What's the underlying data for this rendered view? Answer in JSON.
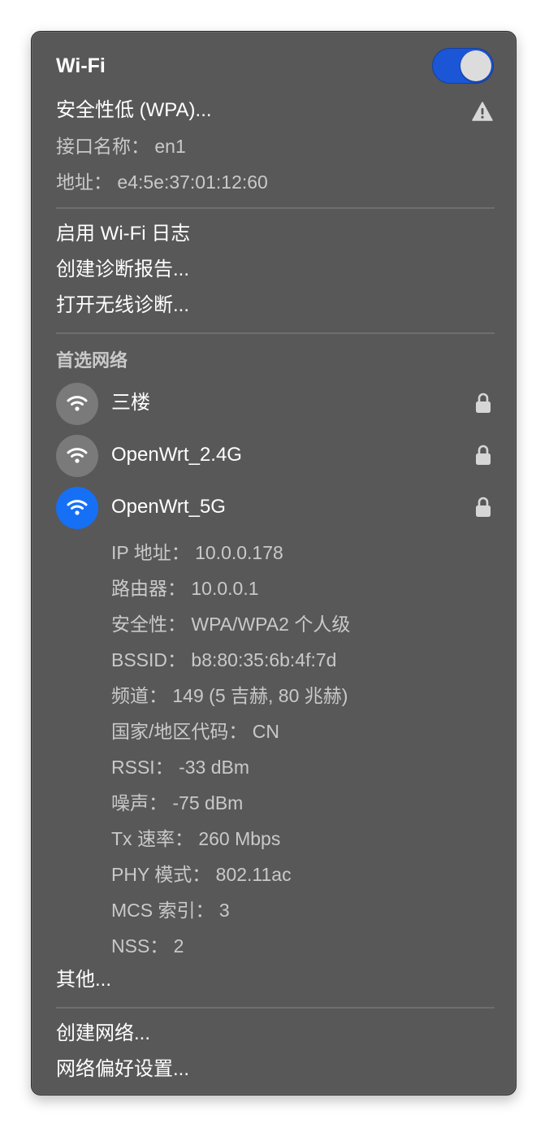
{
  "header": {
    "title": "Wi-Fi",
    "toggle_on": true,
    "security_warning": "安全性低 (WPA)...",
    "interface_name": "接口名称： en1",
    "address": "地址： e4:5e:37:01:12:60"
  },
  "diagnostics": {
    "enable_log": "启用 Wi-Fi 日志",
    "create_report": "创建诊断报告...",
    "open_wireless_diag": "打开无线诊断..."
  },
  "preferred": {
    "heading": "首选网络",
    "networks": [
      {
        "name": "三楼",
        "locked": true,
        "active": false
      },
      {
        "name": "OpenWrt_2.4G",
        "locked": true,
        "active": false
      },
      {
        "name": "OpenWrt_5G",
        "locked": true,
        "active": true
      }
    ]
  },
  "details": {
    "ip": "IP 地址： 10.0.0.178",
    "router": "路由器： 10.0.0.1",
    "security": "安全性： WPA/WPA2 个人级",
    "bssid": "BSSID： b8:80:35:6b:4f:7d",
    "channel": "频道： 149 (5 吉赫, 80 兆赫)",
    "country": "国家/地区代码： CN",
    "rssi": "RSSI： -33 dBm",
    "noise": "噪声： -75 dBm",
    "tx_rate": "Tx 速率： 260 Mbps",
    "phy_mode": "PHY 模式： 802.11ac",
    "mcs_index": "MCS 索引： 3",
    "nss": "NSS： 2"
  },
  "other": "其他...",
  "footer": {
    "create_network": "创建网络...",
    "network_prefs": "网络偏好设置..."
  },
  "colors": {
    "menu_bg": "#585858",
    "toggle_on": "#1a56d6",
    "active_network": "#1670f5"
  },
  "icons": [
    "warning-icon",
    "wifi-icon",
    "lock-icon"
  ]
}
